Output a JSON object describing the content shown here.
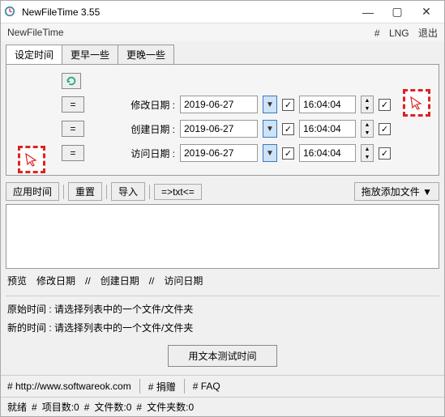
{
  "window": {
    "title": "NewFileTime 3.55",
    "appname": "NewFileTime"
  },
  "menuright": {
    "hash": "#",
    "lng": "LNG",
    "exit": "退出"
  },
  "tabs": {
    "set": "设定时间",
    "earlier": "更早一些",
    "later": "更晚一些"
  },
  "rows": {
    "modify": {
      "label": "修改日期 :",
      "date": "2019-06-27",
      "time": "16:04:04",
      "eq": "="
    },
    "create": {
      "label": "创建日期 :",
      "date": "2019-06-27",
      "time": "16:04:04",
      "eq": "="
    },
    "access": {
      "label": "访问日期 :",
      "date": "2019-06-27",
      "time": "16:04:04",
      "eq": "="
    }
  },
  "toolbar": {
    "apply": "应用时间",
    "reset": "重置",
    "import": "导入",
    "txt": "=>txt<=",
    "drag": "拖放添加文件",
    "dropdown": "▼"
  },
  "preview": {
    "label": "预览",
    "sep": "//",
    "modify": "修改日期",
    "create": "创建日期",
    "access": "访问日期"
  },
  "info": {
    "origlabel": "原始时间 :",
    "orig": "请选择列表中的一个文件/文件夹",
    "newlabel": "新的时间 :",
    "newv": "请选择列表中的一个文件/文件夹"
  },
  "test": "用文本测试时间",
  "footer": {
    "site": "# http://www.softwareok.com",
    "donate": "# 捐赠",
    "faq": "# FAQ"
  },
  "status": {
    "ready": "就绪",
    "items": "项目数:0",
    "files": "文件数:0",
    "folders": "文件夹数:0",
    "sep": "#"
  },
  "check": "✓"
}
